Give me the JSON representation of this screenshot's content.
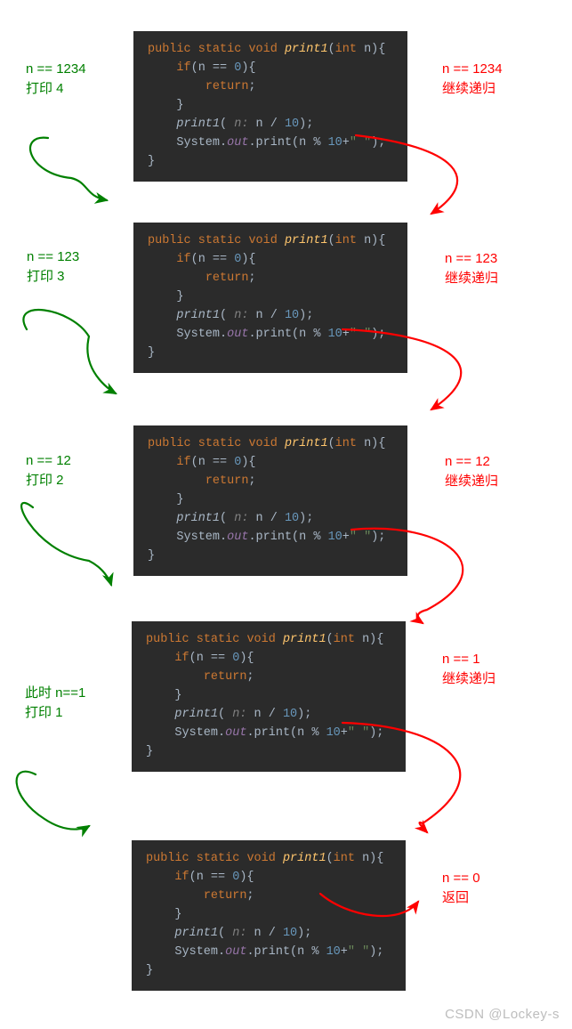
{
  "code": {
    "l1_public": "public",
    "l1_static": "static",
    "l1_void": "void",
    "l1_func": "print1",
    "l1_int": "int",
    "l1_param": " n){",
    "l2_if": "if",
    "l2_cond": "(n == ",
    "l2_zero": "0",
    "l2_close": "){",
    "l3_return": "return",
    "l3_semi": ";",
    "l4_brace": "}",
    "l5_call": "print1",
    "l5_open": "(",
    "l5_hint": " n: ",
    "l5_expr": "n / ",
    "l5_ten": "10",
    "l5_close": ")",
    "l5_semi": ";",
    "l6_sys": "System.",
    "l6_out": "out",
    "l6_print": ".print(n % ",
    "l6_ten": "10",
    "l6_plus": "+",
    "l6_str": "\" \"",
    "l6_close": ");",
    "l7_brace": "}"
  },
  "green_labels": {
    "g1": "n == 1234\n打印 4",
    "g2": "n == 123\n打印 3",
    "g3": "n == 12\n打印 2",
    "g4": "此时 n==1\n打印 1"
  },
  "red_labels": {
    "r1": "n == 1234\n继续递归",
    "r2": "n == 123\n继续递归",
    "r3": "n == 12\n继续递归",
    "r4": "n == 1\n继续递归",
    "r5": "n == 0\n返回"
  },
  "watermark": "CSDN @Lockey-s",
  "arrows": {
    "green_paths": [
      "M 54 155 C 20 150, 30 195, 80 200 C 100 205, 95 220, 120 225",
      "M 30 370 C 10 335, 80 345, 100 378 C 90 420, 130 442, 130 442",
      "M 37 570 C 5 545, 35 620, 100 630 C 120 640, 125 657, 125 657",
      "M 40 870 C 10 855, 10 895, 50 920 C 80 940, 100 928, 100 928"
    ],
    "red_paths": [
      "M 400 152 C 510 165, 545 200, 485 240",
      "M 385 370 C 500 375, 560 410, 485 460",
      "M 395 595 C 505 585, 565 640, 480 685 C 460 690, 475 700, 475 700",
      "M 385 812 C 500 815, 565 865, 475 925 C 465 920, 480 935, 480 935",
      "M 360 1004 C 390 1030, 450 1040, 470 1013"
    ]
  }
}
